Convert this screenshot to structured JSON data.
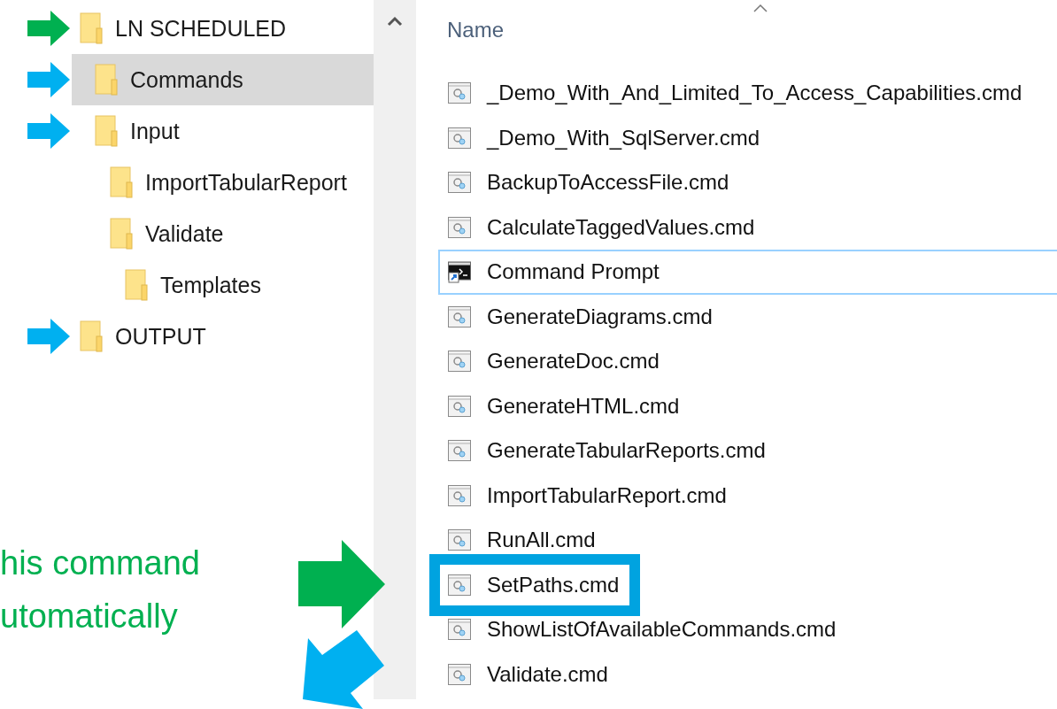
{
  "tree": [
    {
      "label": "LN SCHEDULED",
      "selected": false,
      "annotation_arrow": {
        "color": "#00b050"
      },
      "children": [
        {
          "label": "Commands",
          "selected": true,
          "annotation_arrow": {
            "color": "#00b0f0"
          }
        },
        {
          "label": "Input",
          "selected": false,
          "annotation_arrow": {
            "color": "#00b0f0"
          },
          "children": [
            {
              "label": "ImportTabularReport",
              "selected": false
            },
            {
              "label": "Validate",
              "selected": false,
              "children": [
                {
                  "label": "Templates",
                  "selected": false
                }
              ]
            }
          ]
        }
      ]
    },
    {
      "label": "OUTPUT",
      "selected": false,
      "annotation_arrow": {
        "color": "#00b0f0"
      }
    }
  ],
  "file_list": {
    "column": "Name",
    "files": [
      {
        "name": "_Demo_With_And_Limited_To_Access_Capabilities.cmd",
        "kind": "cmd",
        "focused": false,
        "highlighted": false
      },
      {
        "name": "_Demo_With_SqlServer.cmd",
        "kind": "cmd",
        "focused": false,
        "highlighted": false
      },
      {
        "name": "BackupToAccessFile.cmd",
        "kind": "cmd",
        "focused": false,
        "highlighted": false
      },
      {
        "name": "CalculateTaggedValues.cmd",
        "kind": "cmd",
        "focused": false,
        "highlighted": false
      },
      {
        "name": "Command Prompt",
        "kind": "shortcut",
        "focused": true,
        "highlighted": false
      },
      {
        "name": "GenerateDiagrams.cmd",
        "kind": "cmd",
        "focused": false,
        "highlighted": false
      },
      {
        "name": "GenerateDoc.cmd",
        "kind": "cmd",
        "focused": false,
        "highlighted": false
      },
      {
        "name": "GenerateHTML.cmd",
        "kind": "cmd",
        "focused": false,
        "highlighted": false
      },
      {
        "name": "GenerateTabularReports.cmd",
        "kind": "cmd",
        "focused": false,
        "highlighted": false
      },
      {
        "name": "ImportTabularReport.cmd",
        "kind": "cmd",
        "focused": false,
        "highlighted": false
      },
      {
        "name": "RunAll.cmd",
        "kind": "cmd",
        "focused": false,
        "highlighted": false
      },
      {
        "name": "SetPaths.cmd",
        "kind": "cmd",
        "focused": false,
        "highlighted": true
      },
      {
        "name": "ShowListOfAvailableCommands.cmd",
        "kind": "cmd",
        "focused": false,
        "highlighted": false
      },
      {
        "name": "Validate.cmd",
        "kind": "cmd",
        "focused": false,
        "highlighted": false
      }
    ]
  },
  "callout": {
    "color": "#00b050",
    "lines": [
      "his command",
      "utomatically"
    ]
  },
  "callout_arrows": [
    {
      "kind": "right",
      "color": "#00b050"
    },
    {
      "kind": "diagonal",
      "color": "#00b0f0"
    }
  ]
}
